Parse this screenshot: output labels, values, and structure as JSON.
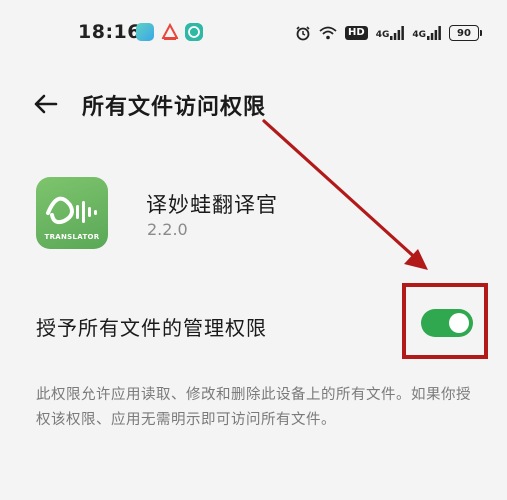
{
  "status_bar": {
    "time": "18:16",
    "hd_label": "HD",
    "network_label_1": "4G",
    "network_label_2": "4G",
    "battery_level": "90"
  },
  "header": {
    "title": "所有文件访问权限",
    "back_icon": "arrow-left-icon"
  },
  "app": {
    "name": "译妙蛙翻译官",
    "version": "2.2.0",
    "icon_label": "TRANSLATOR"
  },
  "permission": {
    "label": "授予所有文件的管理权限",
    "enabled": true,
    "description": "此权限允许应用读取、修改和删除此设备上的所有文件。如果你授权该权限、应用无需明示即可访问所有文件。"
  },
  "colors": {
    "toggle_on": "#2fa84f",
    "annotation": "#b21a1a",
    "app_icon": "#6bb65f"
  }
}
